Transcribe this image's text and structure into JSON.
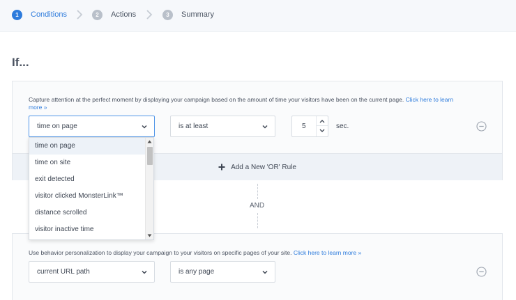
{
  "stepper": {
    "steps": [
      {
        "number": "1",
        "label": "Conditions"
      },
      {
        "number": "2",
        "label": "Actions"
      },
      {
        "number": "3",
        "label": "Summary"
      }
    ]
  },
  "heading": "If...",
  "rule1": {
    "description": "Capture attention at the perfect moment by displaying your campaign based on the amount of time your visitors have been on the current page.",
    "learn_more_line1": "Click here to learn",
    "learn_more_line2": "more »",
    "condition_value": "time on page",
    "operator_value": "is at least",
    "number_value": "5",
    "unit": "sec.",
    "add_or_rule": "Add a New 'OR' Rule"
  },
  "connector": "AND",
  "dropdown": {
    "options": [
      "time on page",
      "time on site",
      "exit detected",
      "visitor clicked MonsterLink™",
      "distance scrolled",
      "visitor inactive time"
    ],
    "highlighted_index": 0
  },
  "rule2": {
    "description": "Use behavior personalization to display your campaign to your visitors on specific pages of your site.",
    "learn_more": "Click here to learn more »",
    "condition_value": "current URL path",
    "operator_value": "is any page"
  },
  "colors": {
    "accent": "#2d7bdc",
    "inactive_step": "#b9c0ca"
  }
}
